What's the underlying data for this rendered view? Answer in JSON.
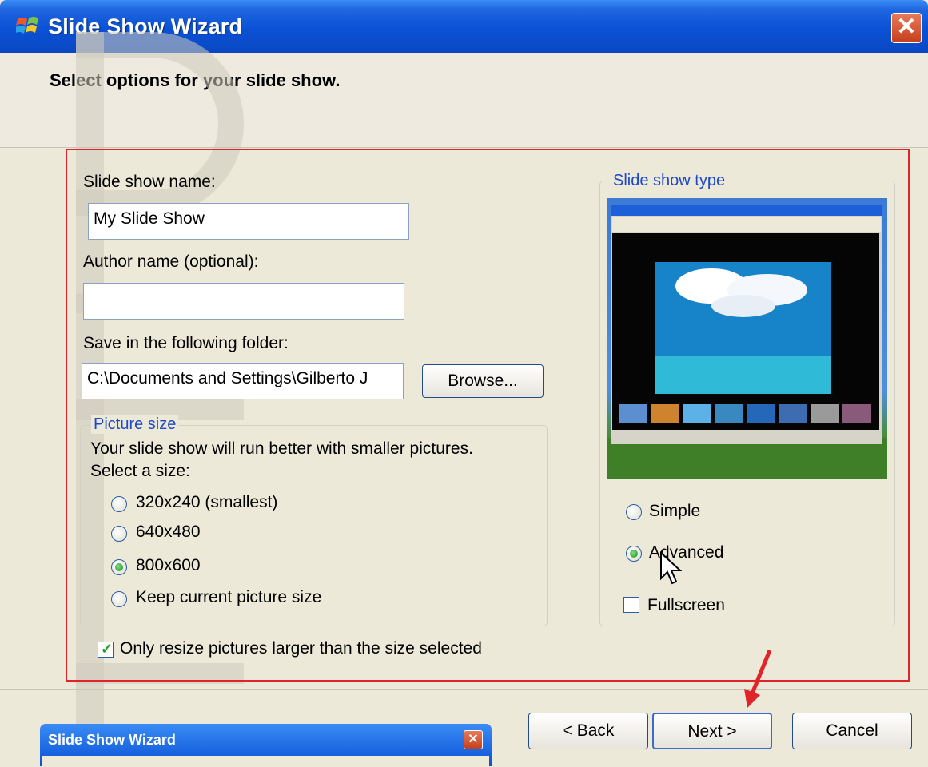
{
  "window": {
    "title": "Slide Show Wizard",
    "close_glyph": "✕"
  },
  "header": {
    "title": "Select options for your slide show."
  },
  "form": {
    "name_label": "Slide show name:",
    "name_value": "My Slide Show",
    "author_label": "Author name (optional):",
    "author_value": "",
    "folder_label": "Save in the following folder:",
    "folder_value": "C:\\Documents and Settings\\Gilberto J",
    "browse_label": "Browse..."
  },
  "picture_size": {
    "legend": "Picture size",
    "description": "Your slide show will run better with smaller pictures.",
    "select_prompt": "Select a size:",
    "options": [
      "320x240 (smallest)",
      "640x480",
      "800x600",
      "Keep current picture size"
    ],
    "selected": "800x600",
    "resize_only_larger_label": "Only resize pictures larger than the size selected",
    "resize_only_larger_checked": true
  },
  "slide_show_type": {
    "legend": "Slide show type",
    "options": [
      "Simple",
      "Advanced"
    ],
    "selected": "Advanced",
    "fullscreen_label": "Fullscreen",
    "fullscreen_checked": false
  },
  "buttons": {
    "back": "< Back",
    "next": "Next >",
    "cancel": "Cancel"
  },
  "mini_dialog": {
    "title": "Slide Show Wizard",
    "close_glyph": "✕"
  },
  "colors": {
    "highlight_border": "#e0242a",
    "titlebar": "#0a51d6",
    "legend_text": "#1d48c8"
  }
}
